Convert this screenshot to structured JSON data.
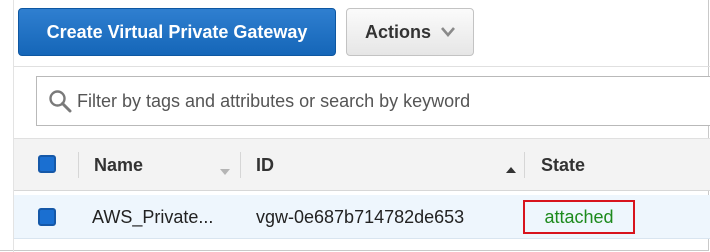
{
  "toolbar": {
    "create_label": "Create Virtual Private Gateway",
    "actions_label": "Actions"
  },
  "search": {
    "placeholder": "Filter by tags and attributes or search by keyword",
    "value": ""
  },
  "table": {
    "columns": {
      "name": "Name",
      "id": "ID",
      "state": "State"
    },
    "rows": [
      {
        "name": "AWS_Private...",
        "id": "vgw-0e687b714782de653",
        "state": "attached",
        "selected": true
      }
    ]
  },
  "colors": {
    "primary": "#1566b8",
    "state_attached": "#1d8a1d",
    "highlight_border": "#d8141d"
  }
}
